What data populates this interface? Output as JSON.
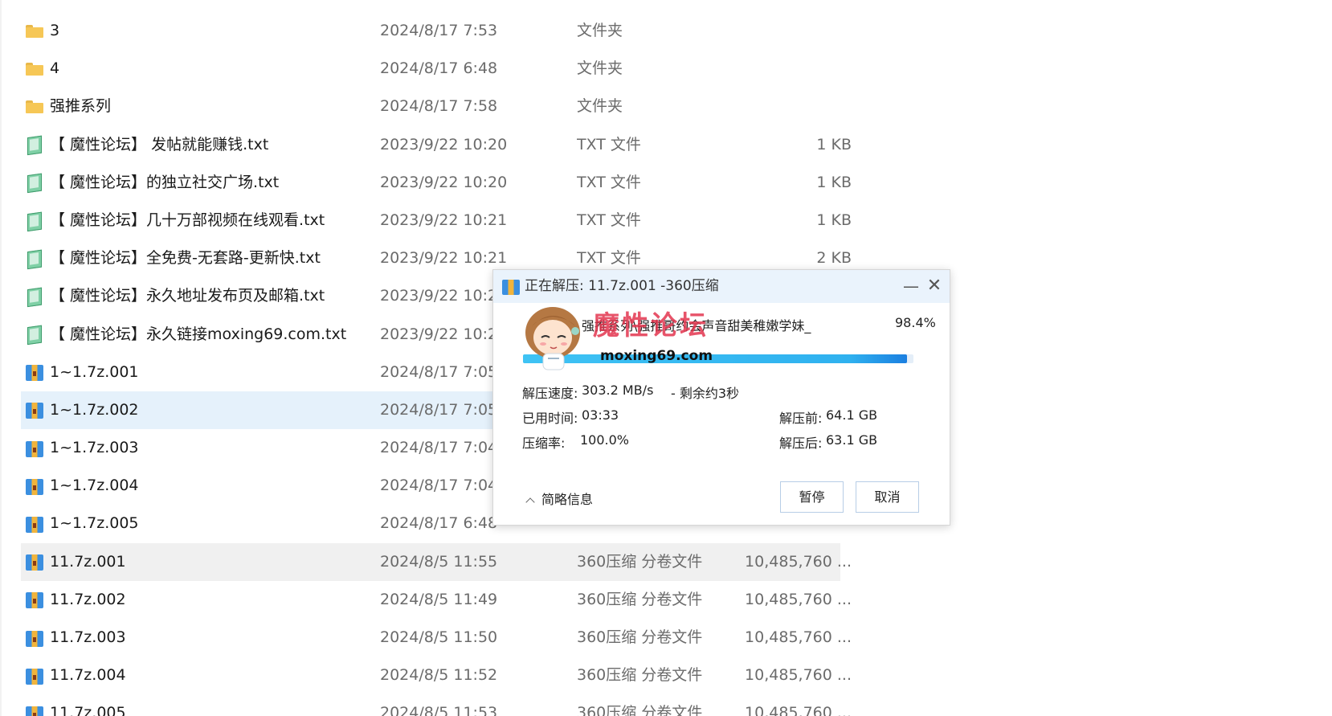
{
  "file_list": {
    "rows": [
      {
        "icon": "folder-icon",
        "name": "3",
        "date": "2024/8/17 7:53",
        "type": "文件夹",
        "size": ""
      },
      {
        "icon": "folder-icon",
        "name": "4",
        "date": "2024/8/17 6:48",
        "type": "文件夹",
        "size": ""
      },
      {
        "icon": "folder-icon",
        "name": "强推系列",
        "date": "2024/8/17 7:58",
        "type": "文件夹",
        "size": ""
      },
      {
        "icon": "txt-file-icon",
        "name": "【 魔性论坛】 发帖就能赚钱.txt",
        "date": "2023/9/22 10:20",
        "type": "TXT 文件",
        "size": "1 KB"
      },
      {
        "icon": "txt-file-icon",
        "name": "【 魔性论坛】的独立社交广场.txt",
        "date": "2023/9/22 10:20",
        "type": "TXT 文件",
        "size": "1 KB"
      },
      {
        "icon": "txt-file-icon",
        "name": "【 魔性论坛】几十万部视频在线观看.txt",
        "date": "2023/9/22 10:21",
        "type": "TXT 文件",
        "size": "1 KB"
      },
      {
        "icon": "txt-file-icon",
        "name": "【 魔性论坛】全免费-无套路-更新快.txt",
        "date": "2023/9/22 10:21",
        "type": "TXT 文件",
        "size": "2 KB"
      },
      {
        "icon": "txt-file-icon",
        "name": "【 魔性论坛】永久地址发布页及邮箱.txt",
        "date": "2023/9/22 10:23",
        "type": "",
        "size": ""
      },
      {
        "icon": "txt-file-icon",
        "name": "【 魔性论坛】永久链接moxing69.com.txt",
        "date": "2023/9/22 10:23",
        "type": "",
        "size": ""
      },
      {
        "icon": "archive-icon",
        "name": "1~1.7z.001",
        "date": "2024/8/17 7:05",
        "type": "",
        "size": ""
      },
      {
        "icon": "archive-icon",
        "name": "1~1.7z.002",
        "date": "2024/8/17 7:05",
        "type": "",
        "size": "",
        "state": "selected"
      },
      {
        "icon": "archive-icon",
        "name": "1~1.7z.003",
        "date": "2024/8/17 7:04",
        "type": "",
        "size": ""
      },
      {
        "icon": "archive-icon",
        "name": "1~1.7z.004",
        "date": "2024/8/17 7:04",
        "type": "",
        "size": ""
      },
      {
        "icon": "archive-icon",
        "name": "1~1.7z.005",
        "date": "2024/8/17 6:48",
        "type": "",
        "size": ""
      },
      {
        "icon": "archive-icon",
        "name": "11.7z.001",
        "date": "2024/8/5 11:55",
        "type": "360压缩 分卷文件",
        "size": "10,485,760 ...",
        "state": "hover"
      },
      {
        "icon": "archive-icon",
        "name": "11.7z.002",
        "date": "2024/8/5 11:49",
        "type": "360压缩 分卷文件",
        "size": "10,485,760 ..."
      },
      {
        "icon": "archive-icon",
        "name": "11.7z.003",
        "date": "2024/8/5 11:50",
        "type": "360压缩 分卷文件",
        "size": "10,485,760 ..."
      },
      {
        "icon": "archive-icon",
        "name": "11.7z.004",
        "date": "2024/8/5 11:52",
        "type": "360压缩 分卷文件",
        "size": "10,485,760 ..."
      },
      {
        "icon": "archive-icon",
        "name": "11.7z.005",
        "date": "2024/8/5 11:53",
        "type": "360压缩 分卷文件",
        "size": "10,485,760 ..."
      }
    ]
  },
  "dialog": {
    "title": "正在解压: 11.7z.001 -360压缩",
    "minimize_symbol": "—",
    "close_symbol": "✕",
    "current_file": "强推系列\\强推哥约会声音甜美稚嫩学妹_",
    "percent_text": "98.4%",
    "progress": 0.984,
    "watermark_text": "魔性论坛",
    "watermark_url": "moxing69.com",
    "speed_label": "解压速度:",
    "speed_value": "303.2 MB/s",
    "remaining": "- 剩余约3秒",
    "elapsed_label": "已用时间:",
    "elapsed_value": "03:33",
    "ratio_label": "压缩率:",
    "ratio_value": "100.0%",
    "before_label": "解压前:",
    "before_value": "64.1 GB",
    "after_label": "解压后:",
    "after_value": "63.1 GB",
    "toggle_label": "简略信息",
    "pause_label": "暂停",
    "cancel_label": "取消"
  },
  "colors": {
    "selected_row": "#e5f1fb",
    "hover_row": "#f0f0f0",
    "progress": "#2fb1ef",
    "watermark": "#e3364f"
  }
}
